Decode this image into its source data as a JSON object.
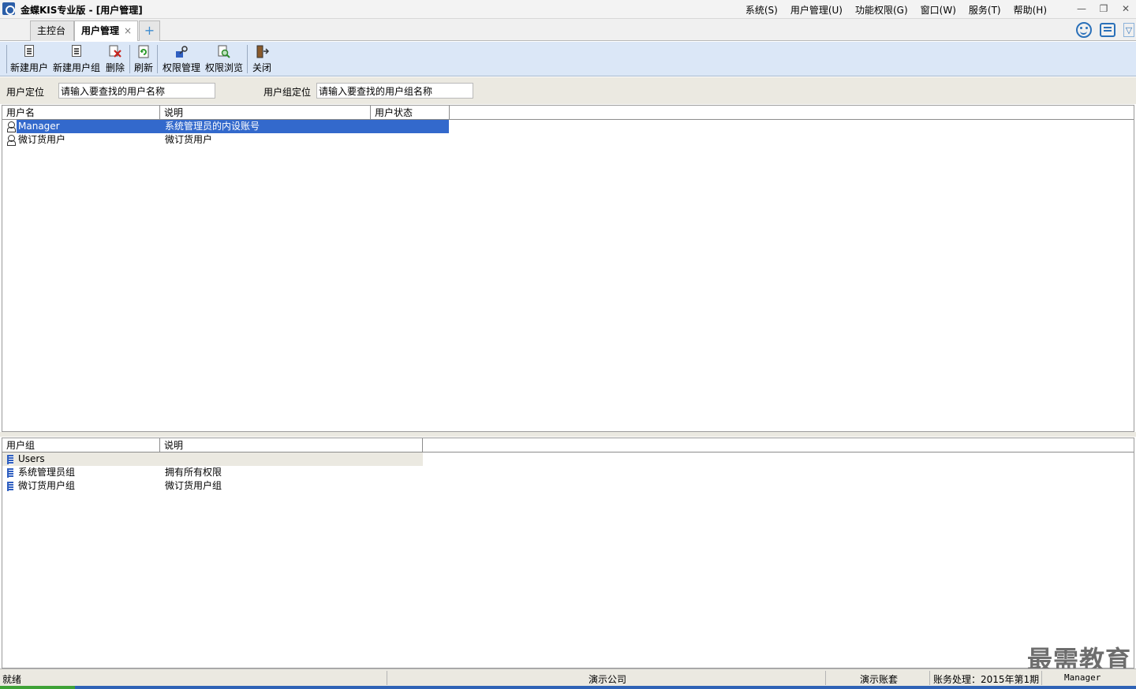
{
  "window": {
    "title": "金蝶KIS专业版 - [用户管理]",
    "menus": [
      "系统(S)",
      "用户管理(U)",
      "功能权限(G)",
      "窗口(W)",
      "服务(T)",
      "帮助(H)"
    ],
    "controls": {
      "minimize": "—",
      "restore": "❐",
      "close": "✕"
    }
  },
  "tabs": {
    "home": "主控台",
    "active": "用户管理",
    "close": "×",
    "add": "+"
  },
  "toolbar": {
    "new_user": "新建用户",
    "new_group": "新建用户组",
    "delete": "删除",
    "refresh": "刷新",
    "perm_manage": "权限管理",
    "perm_browse": "权限浏览",
    "close": "关闭"
  },
  "search": {
    "user_label": "用户定位",
    "user_placeholder": "请输入要查找的用户名称",
    "group_label": "用户组定位",
    "group_placeholder": "请输入要查找的用户组名称"
  },
  "users_table": {
    "headers": [
      "用户名",
      "说明",
      "用户状态"
    ],
    "rows": [
      {
        "name": "Manager",
        "desc": "系统管理员的内设账号",
        "status": ""
      },
      {
        "name": "微订货用户",
        "desc": "微订货用户",
        "status": ""
      }
    ]
  },
  "groups_table": {
    "headers": [
      "用户组",
      "说明"
    ],
    "rows": [
      {
        "name": "Users",
        "desc": ""
      },
      {
        "name": "系统管理员组",
        "desc": "拥有所有权限"
      },
      {
        "name": "微订货用户组",
        "desc": "微订货用户组"
      }
    ]
  },
  "status": {
    "ready": "就绪",
    "company": "演示公司",
    "account_set": "演示账套",
    "period": "账务处理：2015年第1期",
    "user": "Manager"
  },
  "watermark": "最需教育"
}
